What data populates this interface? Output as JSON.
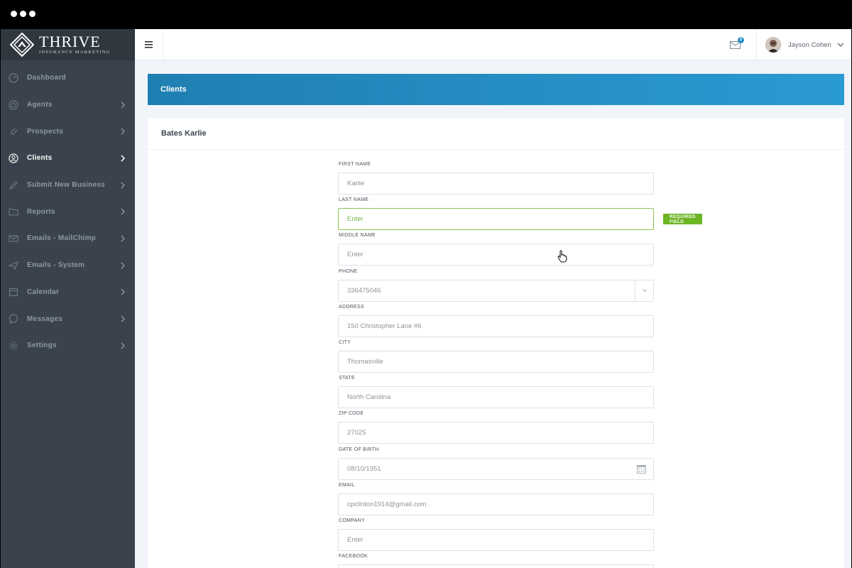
{
  "brand": {
    "name": "THRIVE",
    "tagline": "INSURANCE MARKETING"
  },
  "sidebar": {
    "items": [
      {
        "label": "Dashboard",
        "icon": "dashboard-icon",
        "chevron": false,
        "active": false
      },
      {
        "label": "Agents",
        "icon": "agent-icon",
        "chevron": true,
        "active": false
      },
      {
        "label": "Prospects",
        "icon": "paperclip-icon",
        "chevron": true,
        "active": false
      },
      {
        "label": "Clients",
        "icon": "user-circle-icon",
        "chevron": true,
        "active": true
      },
      {
        "label": "Submit New Business",
        "icon": "pencil-icon",
        "chevron": true,
        "active": false
      },
      {
        "label": "Reports",
        "icon": "folder-icon",
        "chevron": true,
        "active": false
      },
      {
        "label": "Emails - MailChimp",
        "icon": "envelope-icon",
        "chevron": true,
        "active": false
      },
      {
        "label": "Emails - System",
        "icon": "paper-plane-icon",
        "chevron": true,
        "active": false
      },
      {
        "label": "Calendar",
        "icon": "calendar-icon",
        "chevron": true,
        "active": false
      },
      {
        "label": "Messages",
        "icon": "chat-icon",
        "chevron": true,
        "active": false
      },
      {
        "label": "Settings",
        "icon": "gear-icon",
        "chevron": true,
        "active": false
      }
    ]
  },
  "topbar": {
    "mail_count": "2",
    "user_name": "Jayson Cohen"
  },
  "banner": {
    "title": "Clients"
  },
  "card": {
    "title": "Bates Karlie"
  },
  "form": {
    "fields": [
      {
        "label": "FIRST NAME",
        "value": "Karlie"
      },
      {
        "label": "LAST NAME",
        "value": "Enter"
      },
      {
        "label": "MIDDLE NAME",
        "value": "Enter"
      },
      {
        "label": "PHONE",
        "value": "336475046"
      },
      {
        "label": "ADDRESS",
        "value": "150 Christopher Lane #6"
      },
      {
        "label": "CITY",
        "value": "Thomasville"
      },
      {
        "label": "STATE",
        "value": "North Carolina"
      },
      {
        "label": "ZIP CODE",
        "value": "27025"
      },
      {
        "label": "DATE OF BIRTH",
        "value": "08/10/1951"
      },
      {
        "label": "EMAIL",
        "value": "cpclinton1914@gmail.com"
      },
      {
        "label": "COMPANY",
        "value": "Enter"
      },
      {
        "label": "FACEBOOK",
        "value": ""
      }
    ],
    "required_label": "REQUIRED FIELD"
  },
  "colors": {
    "sidebar_bg": "#3a434d",
    "banner_accent": "#2a9bd2",
    "focus_green": "#86c45a",
    "required_green": "#6cb523"
  }
}
